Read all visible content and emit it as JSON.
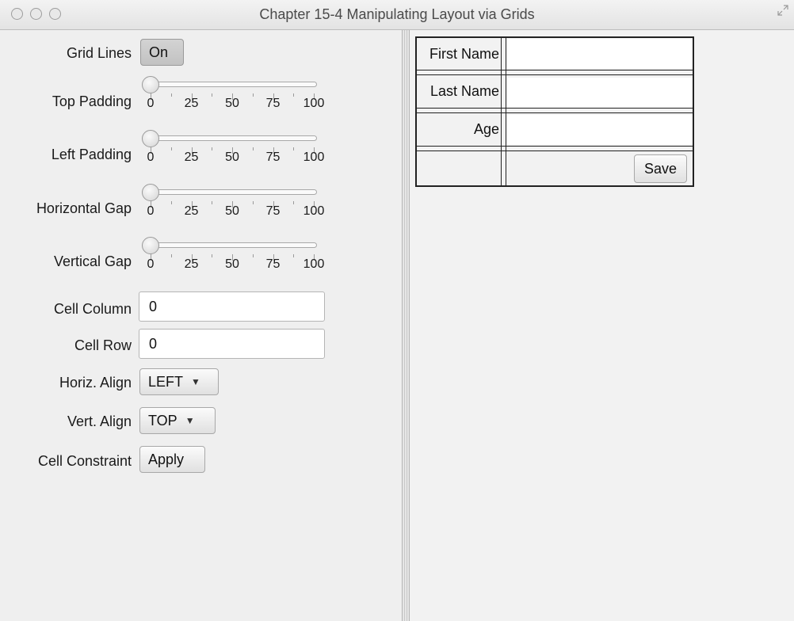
{
  "window": {
    "title": "Chapter 15-4 Manipulating Layout via Grids"
  },
  "controls": {
    "grid_lines": {
      "label": "Grid Lines",
      "value": "On"
    },
    "top_padding": {
      "label": "Top Padding",
      "value": 0
    },
    "left_padding": {
      "label": "Left Padding",
      "value": 0
    },
    "horizontal_gap": {
      "label": "Horizontal Gap",
      "value": 0
    },
    "vertical_gap": {
      "label": "Vertical Gap",
      "value": 0
    },
    "slider_ticks": [
      "0",
      "25",
      "50",
      "75",
      "100"
    ],
    "cell_column": {
      "label": "Cell Column",
      "value": "0"
    },
    "cell_row": {
      "label": "Cell Row",
      "value": "0"
    },
    "horiz_align": {
      "label": "Horiz. Align",
      "value": "LEFT"
    },
    "vert_align": {
      "label": "Vert. Align",
      "value": "TOP"
    },
    "cell_constraint": {
      "label": "Cell Constraint",
      "button": "Apply"
    }
  },
  "form": {
    "first_name_label": "First Name",
    "last_name_label": "Last Name",
    "age_label": "Age",
    "first_name_value": "",
    "last_name_value": "",
    "age_value": "",
    "save_label": "Save"
  },
  "icons": {
    "dropdown": "chevron-down-icon",
    "resize": "fullscreen-icon"
  },
  "colors": {
    "window_bg": "#efefef",
    "grid_line": "#222222",
    "field_bg": "#ffffff"
  }
}
